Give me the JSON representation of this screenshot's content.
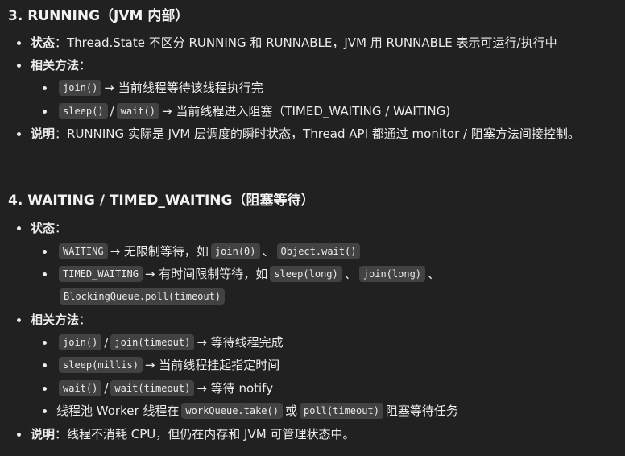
{
  "section3": {
    "title": "3. RUNNING（JVM 内部）",
    "state_label": "状态",
    "state_text": "：Thread.State 不区分 RUNNING 和 RUNNABLE，JVM 用 RUNNABLE 表示可运行/执行中",
    "methods_label": "相关方法",
    "methods_colon": "：",
    "m1_code": "join()",
    "m1_text": "→ 当前线程等待该线程执行完",
    "m2_code1": "sleep()",
    "m2_slash": "/",
    "m2_code2": "wait()",
    "m2_text": "→ 当前线程进入阻塞（TIMED_WAITING / WAITING)",
    "note_label": "说明",
    "note_text": "：RUNNING 实际是 JVM 层调度的瞬时状态，Thread API 都通过 monitor / 阻塞方法间接控制。"
  },
  "section4": {
    "title": "4. WAITING / TIMED_WAITING（阻塞等待）",
    "state_label": "状态",
    "state_colon": "：",
    "s1_code": "WAITING",
    "s1_text": "→ 无限制等待，如",
    "s1_code2": "join(0)",
    "s1_sep": "、",
    "s1_code3": "Object.wait()",
    "s2_code": "TIMED_WAITING",
    "s2_text": "→ 有时间限制等待，如",
    "s2_code2": "sleep(long)",
    "s2_sep1": "、",
    "s2_code3": "join(long)",
    "s2_sep2": "、",
    "s2_code4": "BlockingQueue.poll(timeout)",
    "methods_label": "相关方法",
    "methods_colon": "：",
    "m1_code1": "join()",
    "m1_slash": "/",
    "m1_code2": "join(timeout)",
    "m1_text": "→ 等待线程完成",
    "m2_code": "sleep(millis)",
    "m2_text": "→ 当前线程挂起指定时间",
    "m3_code1": "wait()",
    "m3_slash": "/",
    "m3_code2": "wait(timeout)",
    "m3_text": "→ 等待 notify",
    "m4_text1": "线程池 Worker 线程在",
    "m4_code1": "workQueue.take()",
    "m4_or": "或",
    "m4_code2": "poll(timeout)",
    "m4_text2": "阻塞等待任务",
    "note_label": "说明",
    "note_text": "：线程不消耗 CPU，但仍在内存和 JVM 可管理状态中。"
  }
}
